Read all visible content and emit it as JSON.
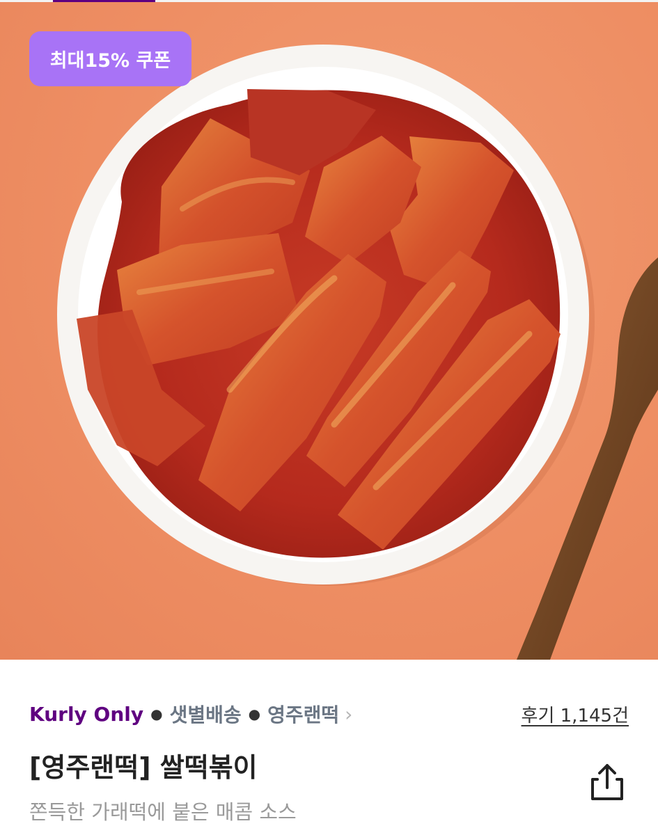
{
  "hero": {
    "coupon_badge": "최대15% 쿠폰",
    "image": "tteokbokki-plate"
  },
  "product": {
    "brand_tag": "Kurly Only",
    "delivery_tag": "샛별배송",
    "brand_link": "영주랜떡",
    "review_link": "후기 1,145건",
    "title": "[영주랜떡] 쌀떡볶이",
    "subtitle": "쫀득한 가래떡에 붙은 매콤 소스"
  },
  "icons": {
    "chevron": "chevron-right-icon",
    "share": "share-icon"
  },
  "colors": {
    "brand_purple": "#5f0080",
    "coupon_purple": "#a873f6",
    "background_orange": "#ee8e63"
  }
}
